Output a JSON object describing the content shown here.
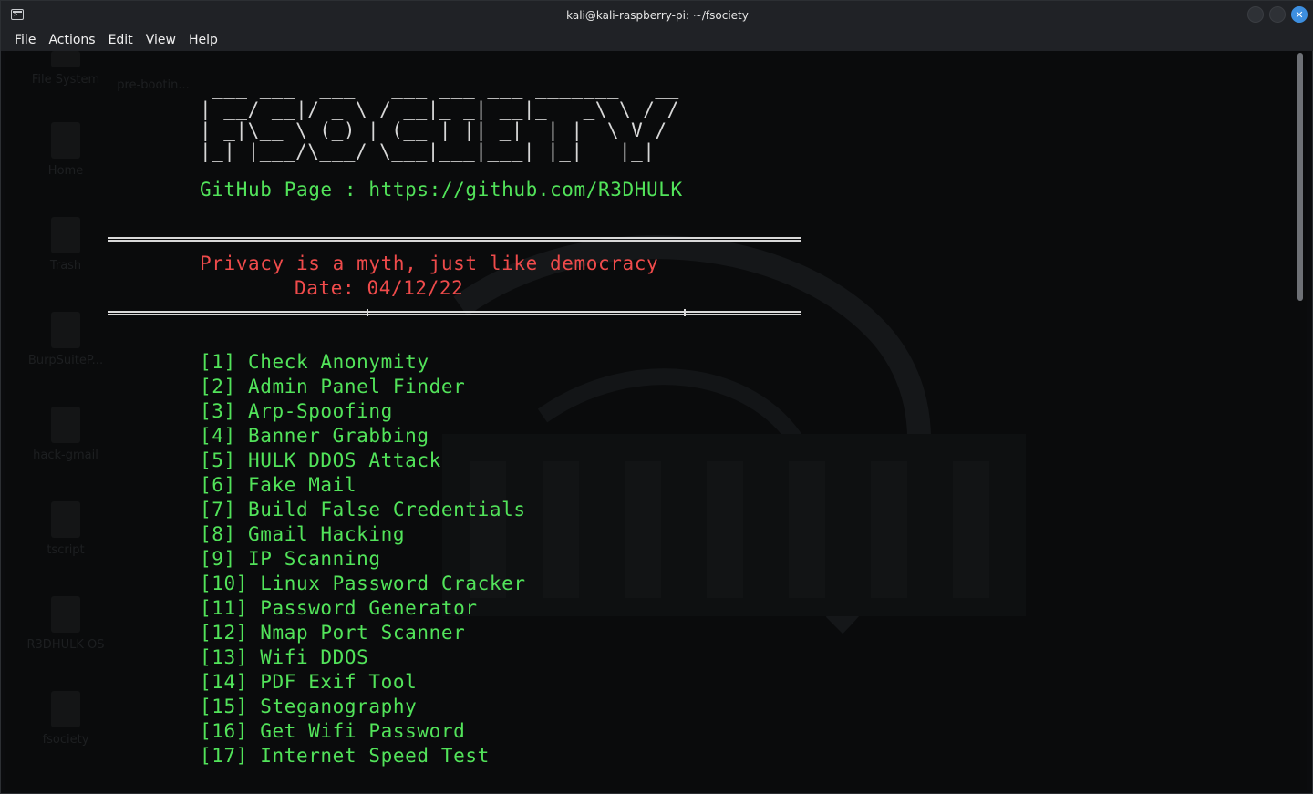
{
  "window": {
    "title": "kali@kali-raspberry-pi: ~/fsociety",
    "controls": {
      "minimize": "−",
      "maximize": "□",
      "close": "✕"
    }
  },
  "menubar": {
    "items": [
      "File",
      "Actions",
      "Edit",
      "View",
      "Help"
    ]
  },
  "desktop": {
    "icons": [
      {
        "label": "File System",
        "icon": "drive-icon"
      },
      {
        "label": "pre-bootin...",
        "icon": "file-icon"
      },
      {
        "label": "Home",
        "icon": "folder-icon"
      },
      {
        "label": "Trash",
        "icon": "trash-icon"
      },
      {
        "label": "BurpSuiteP...",
        "icon": "folder-icon"
      },
      {
        "label": "hack-gmail",
        "icon": "folder-icon"
      },
      {
        "label": "tscript",
        "icon": "folder-icon"
      },
      {
        "label": "R3DHULK OS",
        "icon": "folder-icon"
      },
      {
        "label": "fsociety",
        "icon": "folder-icon"
      }
    ]
  },
  "terminal": {
    "banner_ascii": " ___ ___  ___   ___ ___ ___ _______   __\n| __/ __|/ _ \\ / __|_ _| __|_   _\\ \\ / /\n| _|\\__ \\ (_) | (__ | || _|  | |  \\ V /\n|_| |___/\\___/ \\___|___|___| |_|   |_|",
    "github_line": "GitHub Page : https://github.com/R3DHULK",
    "tagline": "Privacy is a myth, just like democracy",
    "date_line": "Date: 04/12/22",
    "options": [
      "[1] Check Anonymity",
      "[2] Admin Panel Finder",
      "[3] Arp-Spoofing",
      "[4] Banner Grabbing",
      "[5] HULK DDOS Attack",
      "[6] Fake Mail",
      "[7] Build False Credentials",
      "[8] Gmail Hacking",
      "[9] IP Scanning",
      "[10] Linux Password Cracker",
      "[11] Password Generator",
      "[12] Nmap Port Scanner",
      "[13] Wifi DDOS",
      "[14] PDF Exif Tool",
      "[15] Steganography",
      "[16] Get Wifi Password",
      "[17] Internet Speed Test"
    ]
  },
  "colors": {
    "green": "#52e35a",
    "red": "#ef4b4b",
    "banner": "#d7d7d7",
    "close_button": "#3d8fe0"
  }
}
